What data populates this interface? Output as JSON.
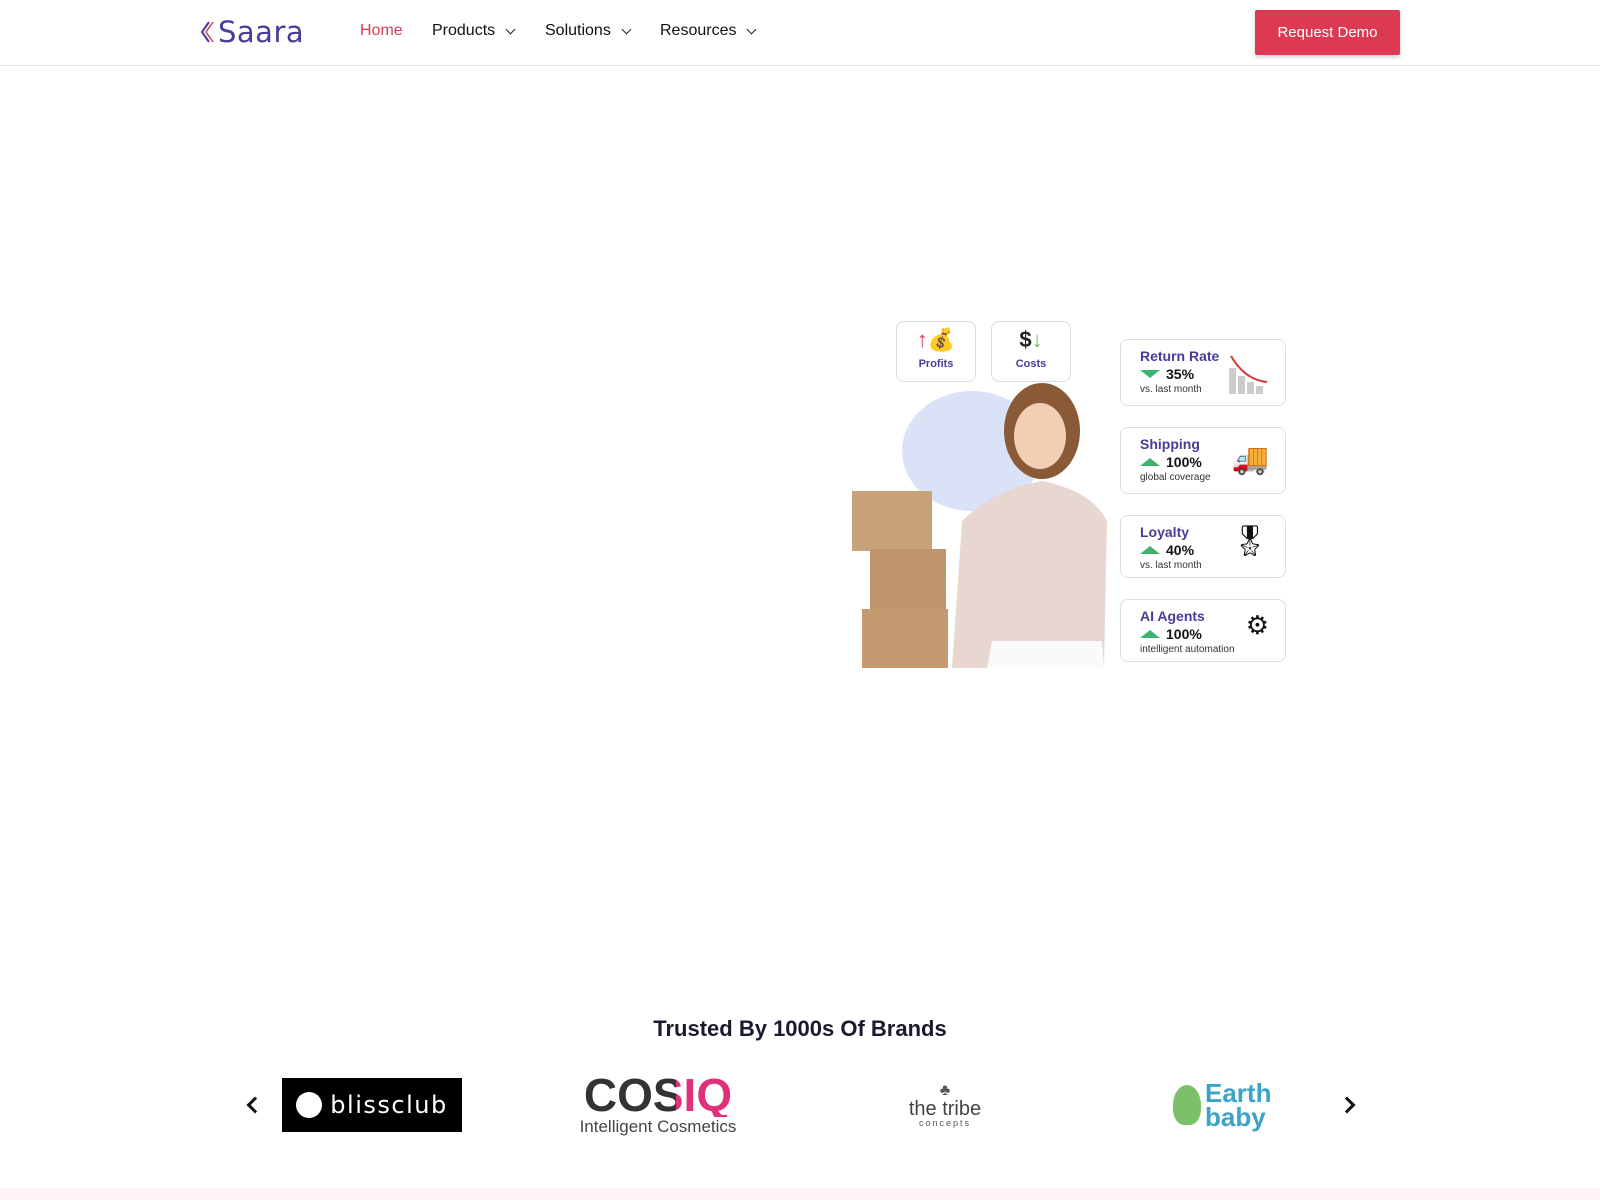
{
  "nav": {
    "logo": "Saara",
    "items": [
      {
        "label": "Home",
        "active": true
      },
      {
        "label": "Products",
        "dropdown": true
      },
      {
        "label": "Solutions",
        "dropdown": true
      },
      {
        "label": "Resources",
        "dropdown": true
      }
    ],
    "cta": "Request Demo"
  },
  "colors": {
    "accent": "#dc3a52",
    "brand": "#4a3b9a",
    "positive": "#3cb371"
  },
  "hero": {
    "mini": [
      {
        "label": "Profits",
        "icon": "money-bag-up-icon"
      },
      {
        "label": "Costs",
        "icon": "dollar-down-icon"
      }
    ],
    "cards": [
      {
        "title": "Return Rate",
        "trend": "down",
        "value": "35%",
        "sub": "vs. last month",
        "icon": "declining-chart-icon"
      },
      {
        "title": "Shipping",
        "trend": "up",
        "value": "100%",
        "sub": "global coverage",
        "icon": "delivery-truck-globe-icon"
      },
      {
        "title": "Loyalty",
        "trend": "up",
        "value": "40%",
        "sub": "vs. last month",
        "icon": "award-ribbon-icon"
      },
      {
        "title": "AI Agents",
        "trend": "up",
        "value": "100%",
        "sub": "intelligent automation",
        "icon": "ai-chip-gear-icon"
      }
    ]
  },
  "trusted": {
    "heading": "Trusted By 1000s Of Brands",
    "brands": [
      "blissclub",
      "COSIQ",
      "Intelligent Cosmetics",
      "the tribe",
      "concepts",
      "Earth baby"
    ]
  }
}
